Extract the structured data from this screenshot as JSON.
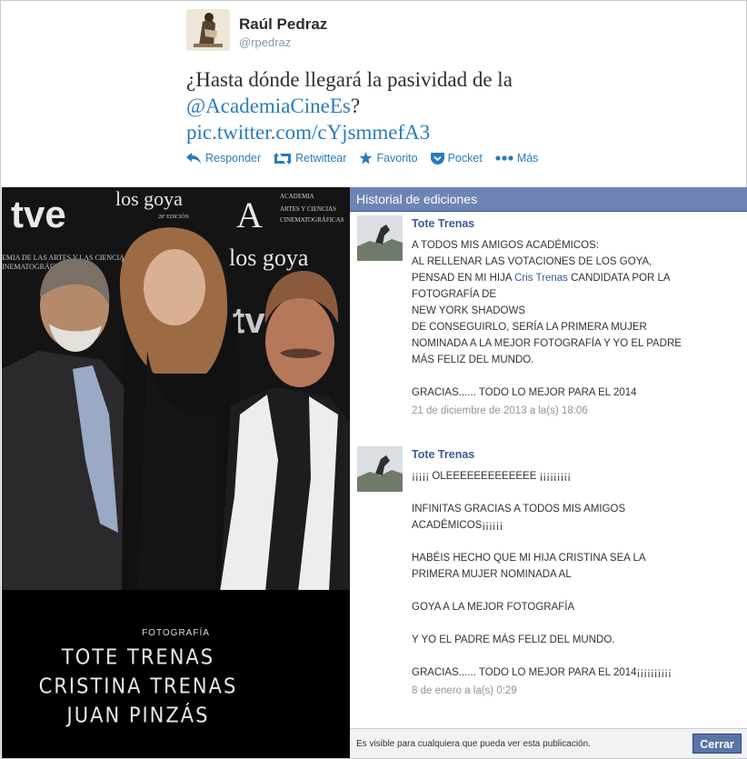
{
  "tweet": {
    "display_name": "Raúl Pedraz",
    "handle": "@rpedraz",
    "text_line1": "¿Hasta dónde llegará la pasividad de la",
    "mention": "@AcademiaCineEs",
    "mention_suffix": "?",
    "pic_link": "pic.twitter.com/cYjsmmefA3",
    "actions": {
      "reply": "Responder",
      "retweet": "Retwittear",
      "favorite": "Favorito",
      "pocket": "Pocket",
      "more": "Más"
    },
    "accent_color": "#2b7bb9"
  },
  "photo": {
    "backdrop_logos": [
      "tve",
      "los goya",
      "28ª EDICIÓN",
      "ACADEMIA",
      "ARTES Y CIENCIAS",
      "CINEMATOGRÁFICAS"
    ],
    "credit_heading": "FOTOGRAFÍA",
    "credit_names": [
      "TOTE TRENAS",
      "CRISTINA TRENAS",
      "JUAN PINZÁS"
    ]
  },
  "fb_panel": {
    "title": "Historial de ediciones",
    "header_color": "#6d84b4",
    "entries": [
      {
        "author": "Tote Trenas",
        "line1": "A TODOS MIS AMIGOS ACADÉMICOS:",
        "line2": "AL RELLENAR LAS VOTACIONES DE LOS GOYA,",
        "line3_pre": "PENSAD EN MI HIJA ",
        "line3_tag": "Cris Trenas",
        "line3_post": " CANDIDATA POR LA",
        "line4": "FOTOGRAFÍA DE",
        "line5": "NEW YORK SHADOWS",
        "line6": "DE CONSEGUIRLO, SERÍA LA PRIMERA MUJER",
        "line7": "NOMINADA A LA MEJOR FOTOGRAFÍA Y YO EL PADRE",
        "line8": "MÁS FELIZ DEL MUNDO.",
        "line9": "GRACIAS...... TODO LO MEJOR PARA EL 2014",
        "date": "21 de diciembre de 2013 a la(s) 18:06"
      },
      {
        "author": "Tote Trenas",
        "line1": "¡¡¡¡¡ OLEEEEEEEEEEEEE ¡¡¡¡¡¡¡¡¡",
        "line2": "INFINITAS GRACIAS A TODOS MIS AMIGOS",
        "line3": "ACADÉMICOS¡¡¡¡¡¡",
        "line4": "HABÉIS HECHO QUE MI HIJA CRISTINA SEA LA",
        "line5": "PRIMERA MUJER NOMINADA AL",
        "line6": "GOYA A LA MEJOR FOTOGRAFÍA",
        "line7": "Y YO EL PADRE MÁS FELIZ DEL MUNDO.",
        "line8": "GRACIAS...... TODO LO MEJOR PARA EL 2014¡¡¡¡¡¡¡¡¡¡",
        "date": "8 de enero a la(s) 0:29"
      }
    ],
    "footer_text": "Es visible para cualquiera que pueda ver esta publicación.",
    "close_label": "Cerrar"
  }
}
